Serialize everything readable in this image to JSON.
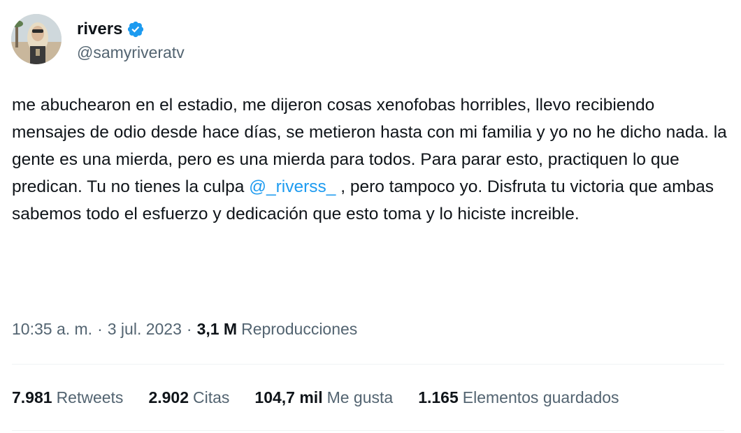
{
  "user": {
    "display_name": "rivers",
    "handle": "@samyriveratv",
    "verified_icon": "verified-badge-icon",
    "badge_color": "#1d9bf0"
  },
  "tweet": {
    "text_before_mention": "me abuchearon en el estadio, me dijeron cosas xenofobas horribles, llevo recibiendo mensajes de odio desde hace días, se metieron hasta con mi familia y yo no he dicho nada. la gente es una mierda, pero es una mierda para todos. Para parar esto, practiquen lo que predican. Tu no tienes la culpa ",
    "mention": "@_riverss_",
    "text_after_mention": " , pero tampoco yo. Disfruta tu victoria que ambas sabemos todo el esfuerzo y dedicación que esto toma y lo hiciste increible."
  },
  "meta": {
    "time": "10:35 a. m.",
    "separator": "·",
    "date": "3 jul. 2023",
    "views_count": "3,1 M",
    "views_label": "Reproducciones"
  },
  "stats": [
    {
      "value": "7.981",
      "label": "Retweets"
    },
    {
      "value": "2.902",
      "label": "Citas"
    },
    {
      "value": "104,7 mil",
      "label": "Me gusta"
    },
    {
      "value": "1.165",
      "label": "Elementos guardados"
    }
  ],
  "colors": {
    "text_primary": "#0f1419",
    "text_secondary": "#536471",
    "accent": "#1d9bf0",
    "divider": "#eff3f4"
  }
}
